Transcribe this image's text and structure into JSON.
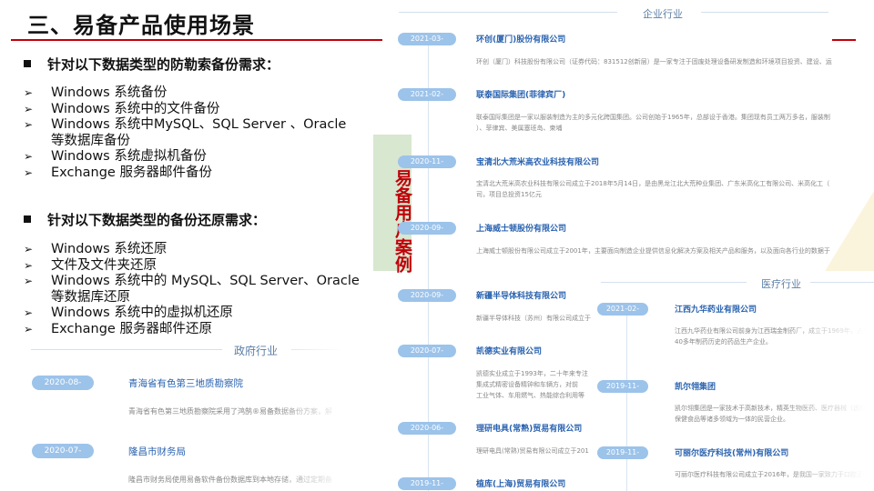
{
  "slide": {
    "title": "三、易备产品使用场景",
    "section1": {
      "heading": "针对以下数据类型的防勒索备份需求：",
      "items": [
        "Windows 系统备份",
        "Windows 系统中的文件备份",
        "Windows 系统中MySQL、SQL Server 、Oracle",
        "等数据库备份",
        "Windows 系统虚拟机备份",
        "Exchange 服务器邮件备份"
      ]
    },
    "section2": {
      "heading": "针对以下数据类型的备份还原需求：",
      "items": [
        "Windows 系统还原",
        "文件及文件夹还原",
        "Windows 系统中的 MySQL、SQL Server、Oracle",
        "等数据库还原",
        "Windows 系统中的虚拟机还原",
        "Exchange 服务器邮件还原"
      ]
    },
    "vertical_tag": "易备用户案例"
  },
  "government": {
    "label": "政府行业",
    "cases": [
      {
        "date": "2020-08-",
        "name": "青海省有色第三地质勘察院",
        "desc": "青海省有色第三地质勘察院采用了鸿鹄®易备数据备份方案，解"
      },
      {
        "date": "2020-07-",
        "name": "隆昌市财务局",
        "desc": "隆昌市财务局使用易备软件备份数据库到本地存储，通过定期备"
      }
    ]
  },
  "enterprise": {
    "label": "企业行业",
    "cases": [
      {
        "date": "2021-03-",
        "name": "环创(厦门)股份有限公司",
        "desc": "环创（厦门）科技股份有限公司（证券代码：831512创新层）是一家专注于固废处理设备研发制造和环境项目投资、建设、运"
      },
      {
        "date": "2021-02-",
        "name": "联泰国际集团(菲律宾厂)",
        "desc": "联泰国际集团是一家以服装制造为主的多元化跨国集团。公司创始于1965年，总部设于香港。集团现有员工两万多名，服装制",
        "desc2": "）、菲律宾、美属塞班岛、柬埔"
      },
      {
        "date": "2020-11-",
        "name": "宝清北大荒米高农业科技有限公司",
        "desc": "宝清北大荒米高农业科技有限公司成立于2018年5月14日，是由黑龙江北大荒种业集团、广东米高化工有限公司、米高化工（",
        "desc2": "司，项目总投资15亿元"
      },
      {
        "date": "2020-09-",
        "name": "上海威士顿股份有限公司",
        "desc": "上海威士顿股份有限公司成立于2001年，主要面向制造企业提供信息化解决方案及相关产品和服务，以及面向各行业的数据于"
      },
      {
        "date": "2020-09-",
        "name": "新疆半导体科技有限公司",
        "desc": "新疆半导体科技（苏州）有限公司成立于"
      },
      {
        "date": "2020-07-",
        "name": "凯德实业有限公司",
        "desc": "凯德实业成立于1993年，二十年来专注",
        "desc2": "集成式精密设备精钟和车辆方，对前",
        "desc3": "工业气体、车用燃气、热能综合利用等"
      },
      {
        "date": "2020-06-",
        "name": "理研电具(常熟)贸易有限公司",
        "desc": "理研电具(常熟)贸易有限公司成立于201"
      },
      {
        "date": "2019-11-",
        "name": "植库(上海)贸易有限公司",
        "desc": ""
      }
    ]
  },
  "medical": {
    "label": "医疗行业",
    "cases": [
      {
        "date": "2021-02-",
        "name": "江西九华药业有限公司",
        "desc": "江西九华药业有限公司前身为江西瑞金制药厂，成立于1969年，占地",
        "desc2": "40多年制药历史的药品生产企业。"
      },
      {
        "date": "2019-11-",
        "name": "凯尔翎集团",
        "desc": "凯尔翎集团是一家技术于高新技术，精英生物医药、医疗器械（透析",
        "desc2": "保健食品等诸多领域为一体的民营企业。"
      },
      {
        "date": "2019-11-",
        "name": "可丽尔医疗科技(常州)有限公司",
        "desc": "可丽尔医疗科技有限公司成立于2016年，是我国一家致力于口腔正畸和"
      }
    ]
  },
  "colors": {
    "accent_red": "#c0000a",
    "pill_blue": "#9cc3ea",
    "link_blue": "#2a63b0",
    "tag_green": "#d8e7cf"
  }
}
